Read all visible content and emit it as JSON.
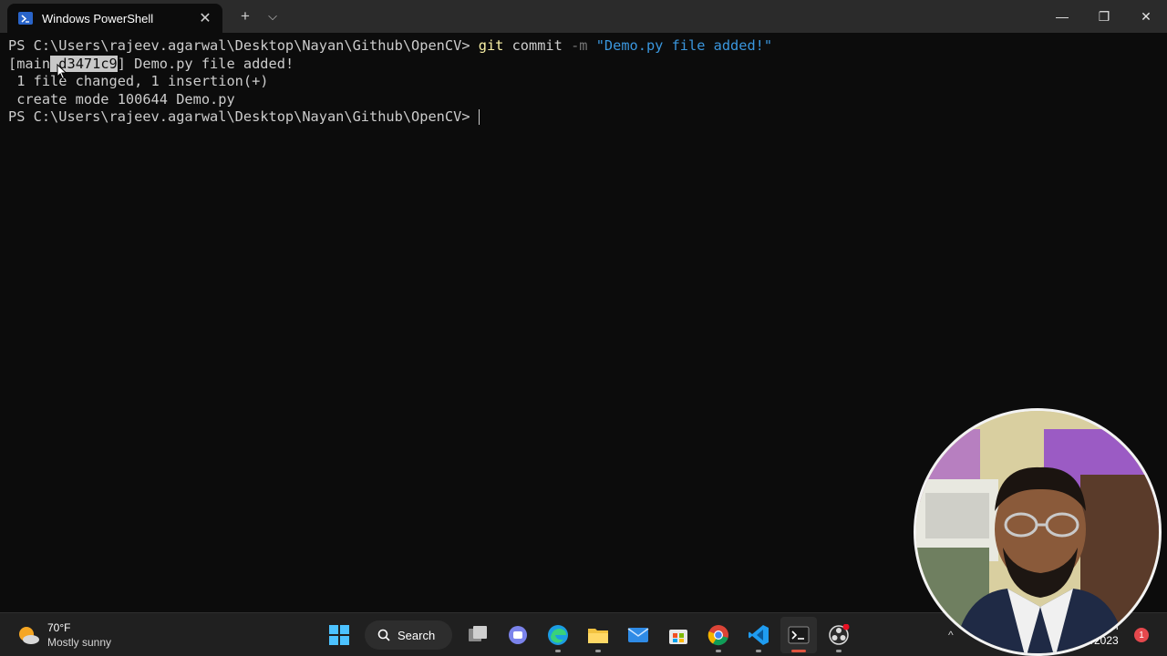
{
  "window": {
    "tab_title": "Windows PowerShell",
    "close_tab": "✕",
    "new_tab": "+",
    "dropdown": "⌵",
    "minimize": "—",
    "restore": "❐",
    "close": "✕"
  },
  "terminal": {
    "line1": {
      "prompt": "PS C:\\Users\\rajeev.agarwal\\Desktop\\Nayan\\Github\\OpenCV> ",
      "git": "git",
      "cmd": " commit ",
      "flag": "-m",
      "space": " ",
      "message": "\"Demo.py file added!\""
    },
    "line2": {
      "open": "[main",
      "hash": " d3471c9",
      "rest": "] Demo.py file added!"
    },
    "line3": " 1 file changed, 1 insertion(+)",
    "line4": " create mode 100644 Demo.py",
    "line5": {
      "prompt": "PS C:\\Users\\rajeev.agarwal\\Desktop\\Nayan\\Github\\OpenCV> "
    }
  },
  "taskbar": {
    "weather_temp": "70°F",
    "weather_condition": "Mostly sunny",
    "search_label": "Search",
    "clock_time": "M",
    "clock_date": "5/2023",
    "notification_count": "1",
    "tray_chevron": "^"
  },
  "colors": {
    "terminal_bg": "#0c0c0c",
    "titlebar_bg": "#2b2b2b",
    "git_keyword": "#f9f1a5",
    "string": "#3a96dd",
    "flag": "#767676",
    "taskbar_bg": "#202020"
  },
  "icons": [
    "powershell-icon",
    "windows-start-icon",
    "search-icon",
    "task-view-icon",
    "teams-chat-icon",
    "edge-icon",
    "file-explorer-icon",
    "mail-icon",
    "store-icon",
    "chrome-icon",
    "vscode-icon",
    "terminal-icon",
    "obs-icon",
    "weather-sun-icon"
  ]
}
